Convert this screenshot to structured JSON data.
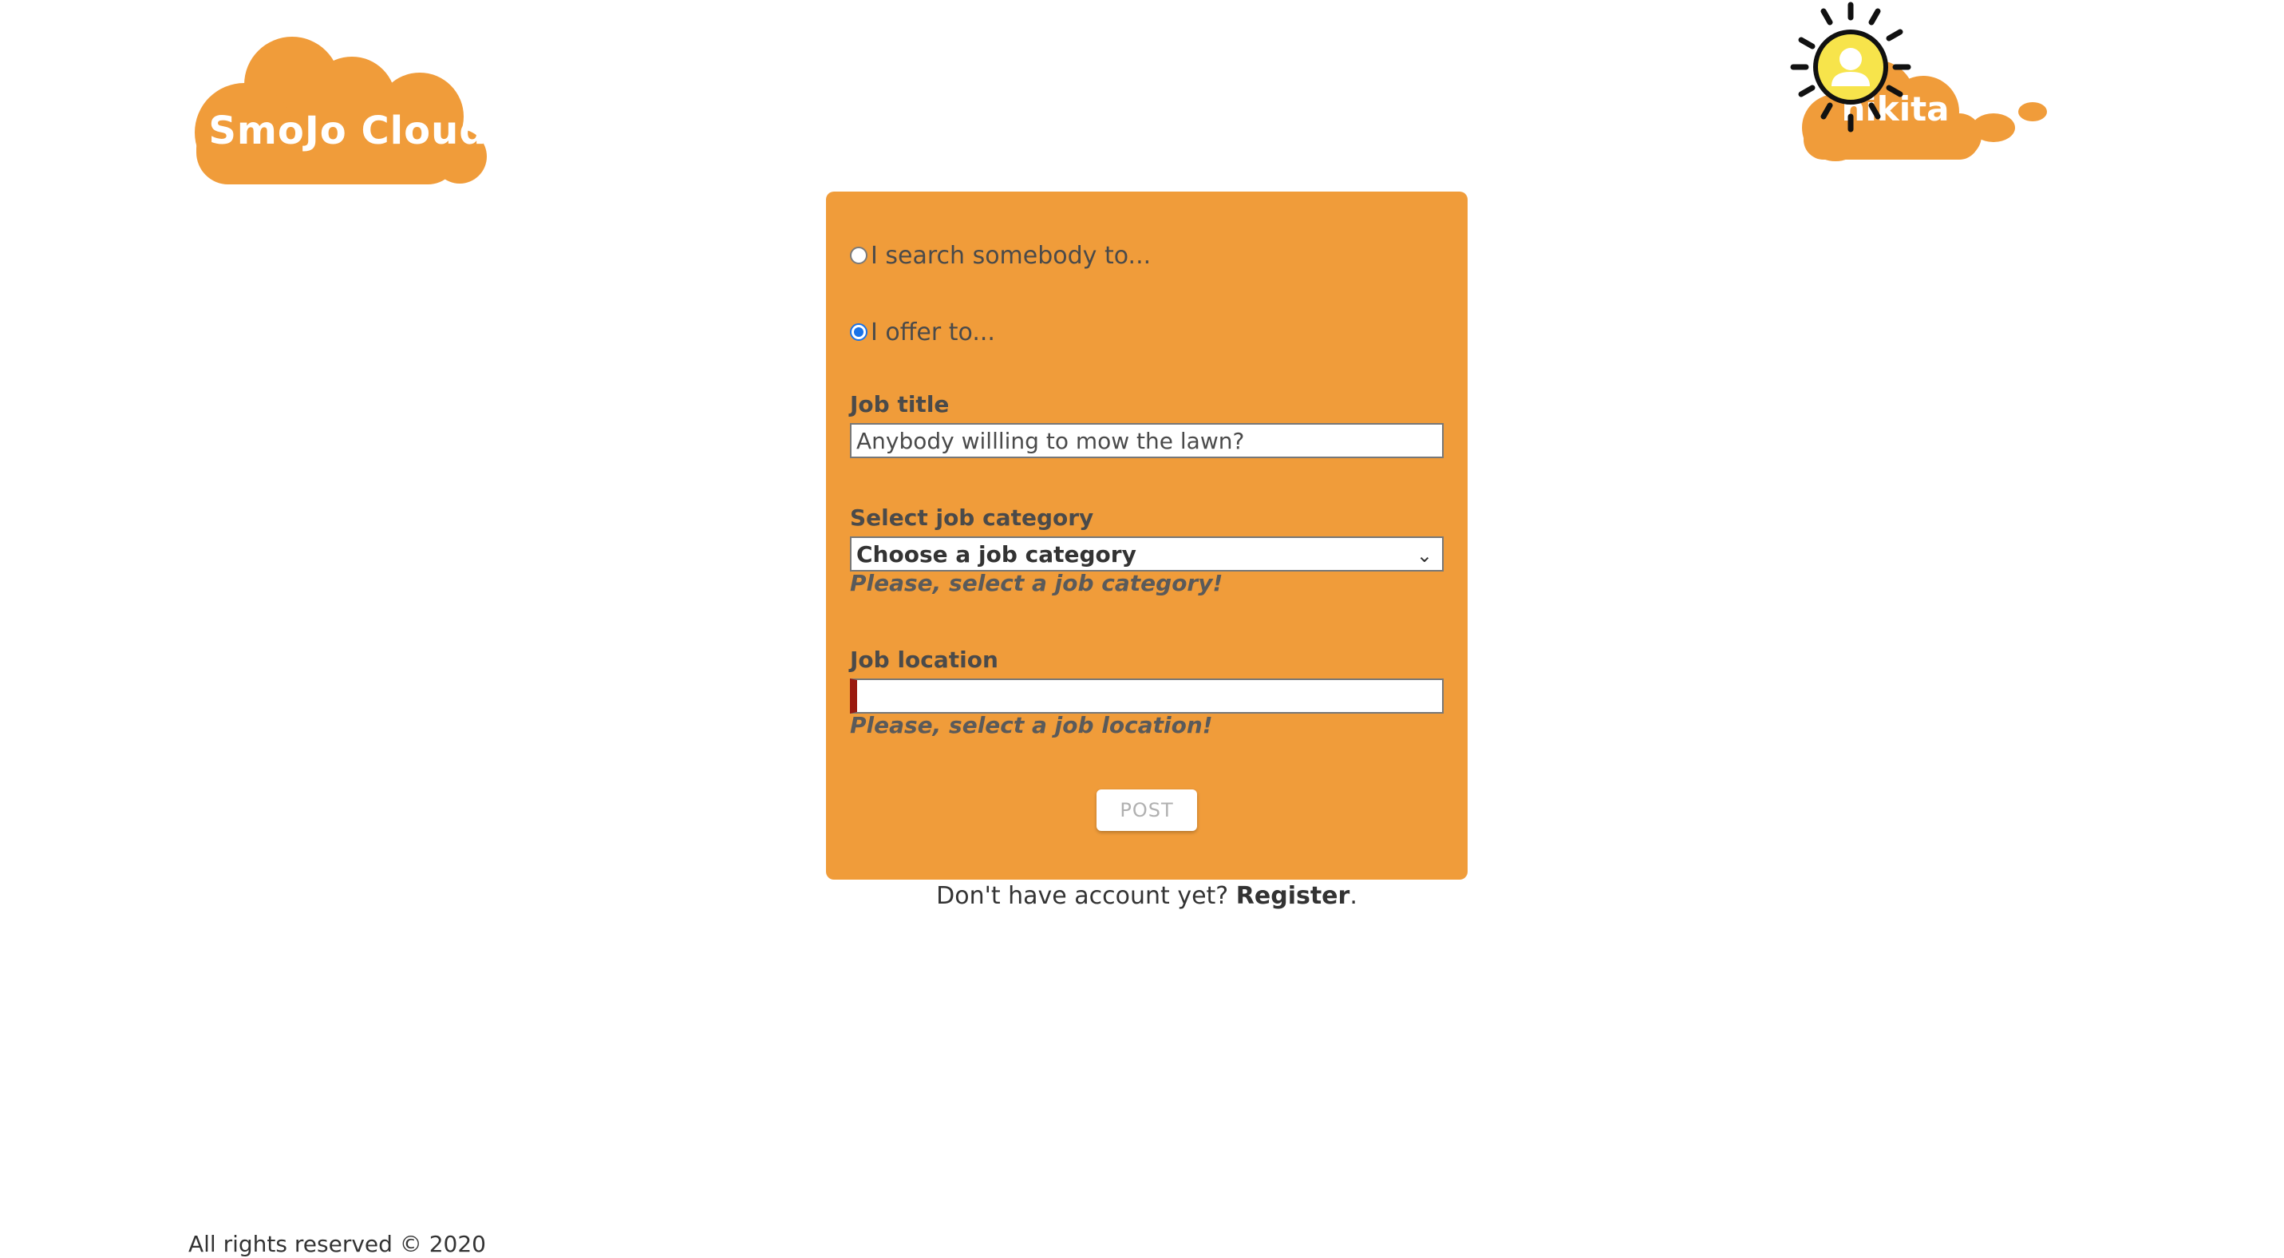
{
  "brand": {
    "logo_text": "SmoJo Cloud",
    "color": "#f09c3a"
  },
  "user": {
    "name": "nikita"
  },
  "form": {
    "radio_search_label": "I search somebody to...",
    "radio_offer_label": "I offer to...",
    "selected_radio": "offer",
    "job_title_label": "Job title",
    "job_title_value": "Anybody willling to mow the lawn?",
    "category_label": "Select job category",
    "category_value": "Choose a job category",
    "category_error": "Please, select a job category!",
    "location_label": "Job location",
    "location_value": "",
    "location_error": "Please, select a job location!",
    "post_label": "POST"
  },
  "register": {
    "prompt": "Don't have account yet?",
    "link": "Register",
    "suffix": "."
  },
  "footer": {
    "text": "All rights reserved © 2020"
  }
}
